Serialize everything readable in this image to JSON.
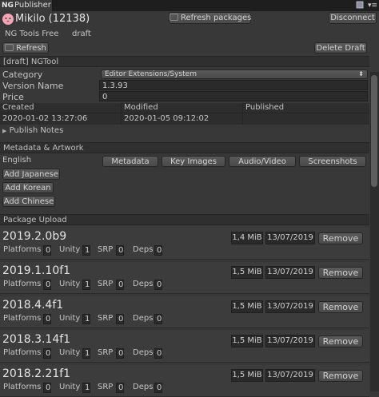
{
  "window": {
    "tab_label": "Publisher",
    "tab_icon": "NG"
  },
  "header": {
    "user": "Mikilo (12138)",
    "refresh_packages": "Refresh packages",
    "disconnect": "Disconnect",
    "package_name": "NG Tools Free",
    "package_status": "draft",
    "refresh": "Refresh",
    "delete_draft": "Delete Draft"
  },
  "details": {
    "section_title": "[draft] NGTool",
    "category_label": "Category",
    "category_value": "Editor Extensions/System",
    "version_label": "Version Name",
    "version_value": "1.3.93",
    "price_label": "Price",
    "price_value": "0",
    "col_created": "Created",
    "col_modified": "Modified",
    "col_published": "Published",
    "created": "2020-01-02 13:27:06",
    "modified": "2020-01-05 09:12:02",
    "published": "",
    "publish_notes": "Publish Notes"
  },
  "metadata": {
    "section_title": "Metadata & Artwork",
    "language": "English",
    "tabs": [
      "Metadata",
      "Key Images",
      "Audio/Video",
      "Screenshots"
    ],
    "add_languages": [
      "Add Japanese",
      "Add Korean",
      "Add Chinese"
    ]
  },
  "upload": {
    "section_title": "Package Upload",
    "labels": {
      "platforms": "Platforms",
      "unity": "Unity",
      "srp": "SRP",
      "deps": "Deps",
      "remove": "Remove"
    },
    "packages": [
      {
        "version": "2019.2.0b9",
        "size": "1,4 MiB",
        "date": "13/07/2019",
        "platforms": "0",
        "unity": "1",
        "srp": "0",
        "deps": "0"
      },
      {
        "version": "2019.1.10f1",
        "size": "1,5 MiB",
        "date": "13/07/2019",
        "platforms": "0",
        "unity": "1",
        "srp": "0",
        "deps": "0"
      },
      {
        "version": "2018.4.4f1",
        "size": "1,5 MiB",
        "date": "13/07/2019",
        "platforms": "0",
        "unity": "1",
        "srp": "0",
        "deps": "0"
      },
      {
        "version": "2018.3.14f1",
        "size": "1,5 MiB",
        "date": "13/07/2019",
        "platforms": "0",
        "unity": "1",
        "srp": "0",
        "deps": "0"
      },
      {
        "version": "2018.2.21f1",
        "size": "1,5 MiB",
        "date": "13/07/2019",
        "platforms": "0",
        "unity": "1",
        "srp": "0",
        "deps": "0"
      }
    ]
  },
  "colors": {
    "background": "#383838",
    "panel_dark": "#2d2d2d",
    "text": "#c8c8c8"
  }
}
